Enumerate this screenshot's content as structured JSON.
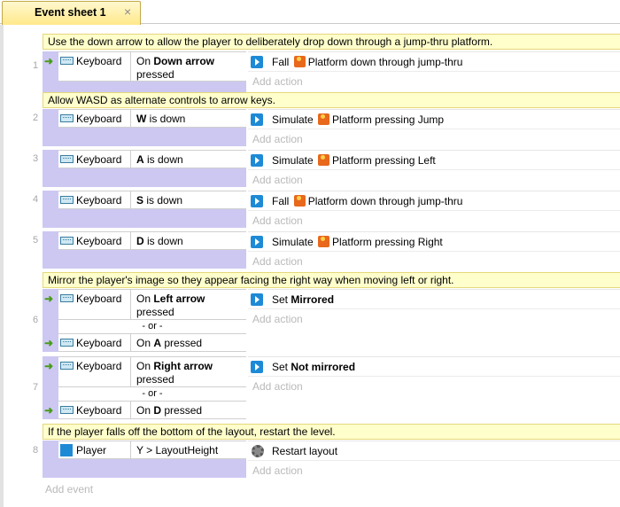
{
  "tab": {
    "label": "Event sheet 1",
    "close": "×"
  },
  "comments": [
    "Use the down arrow to allow the player to deliberately drop down through a jump-thru platform.",
    "Allow WASD as alternate controls to arrow keys.",
    "Mirror the player's image so they appear facing the right way when moving left or right.",
    "If the player falls off the bottom of the layout, restart the level."
  ],
  "events": [
    {
      "num": "1",
      "conditions": [
        {
          "object": "Keyboard",
          "pre": "On ",
          "bold": "Down arrow",
          "post": "pressed"
        }
      ],
      "action": {
        "verb": "Fall",
        "object": "Platform",
        "text": "down through jump-thru"
      }
    },
    {
      "num": "2",
      "conditions": [
        {
          "object": "Keyboard",
          "bold": "W",
          "post": " is down"
        }
      ],
      "action": {
        "verb": "Simulate",
        "object": "Platform",
        "text": "pressing Jump"
      }
    },
    {
      "num": "3",
      "conditions": [
        {
          "object": "Keyboard",
          "bold": "A",
          "post": " is down"
        }
      ],
      "action": {
        "verb": "Simulate",
        "object": "Platform",
        "text": "pressing Left"
      }
    },
    {
      "num": "4",
      "conditions": [
        {
          "object": "Keyboard",
          "bold": "S",
          "post": " is down"
        }
      ],
      "action": {
        "verb": "Fall",
        "object": "Platform",
        "text": "down through jump-thru"
      }
    },
    {
      "num": "5",
      "conditions": [
        {
          "object": "Keyboard",
          "bold": "D",
          "post": " is down"
        }
      ],
      "action": {
        "verb": "Simulate",
        "object": "Platform",
        "text": "pressing Right"
      }
    },
    {
      "num": "6",
      "or": "- or -",
      "conditions": [
        {
          "object": "Keyboard",
          "pre": "On ",
          "bold": "Left arrow",
          "post": "pressed"
        },
        {
          "object": "Keyboard",
          "pre": "On ",
          "bold": "A",
          "post": " pressed"
        }
      ],
      "action": {
        "verb": "Set ",
        "bold": "Mirrored"
      }
    },
    {
      "num": "7",
      "or": "- or -",
      "conditions": [
        {
          "object": "Keyboard",
          "pre": "On ",
          "bold": "Right arrow",
          "post": "pressed"
        },
        {
          "object": "Keyboard",
          "pre": "On ",
          "bold": "D",
          "post": " pressed"
        }
      ],
      "action": {
        "verb": "Set ",
        "bold": "Not mirrored"
      }
    },
    {
      "num": "8",
      "conditions": [
        {
          "object": "Player",
          "text": "Y > LayoutHeight"
        }
      ],
      "action": {
        "text": "Restart layout"
      }
    }
  ],
  "add_action": "Add action",
  "add_event": "Add event",
  "colors": {
    "comment_bg": "#ffffcc",
    "tab_bg": "#ffe98a",
    "side_lavender": "#ccc8f2",
    "trigger_green": "#4a9c1a",
    "action_blue": "#1e8ad6"
  }
}
